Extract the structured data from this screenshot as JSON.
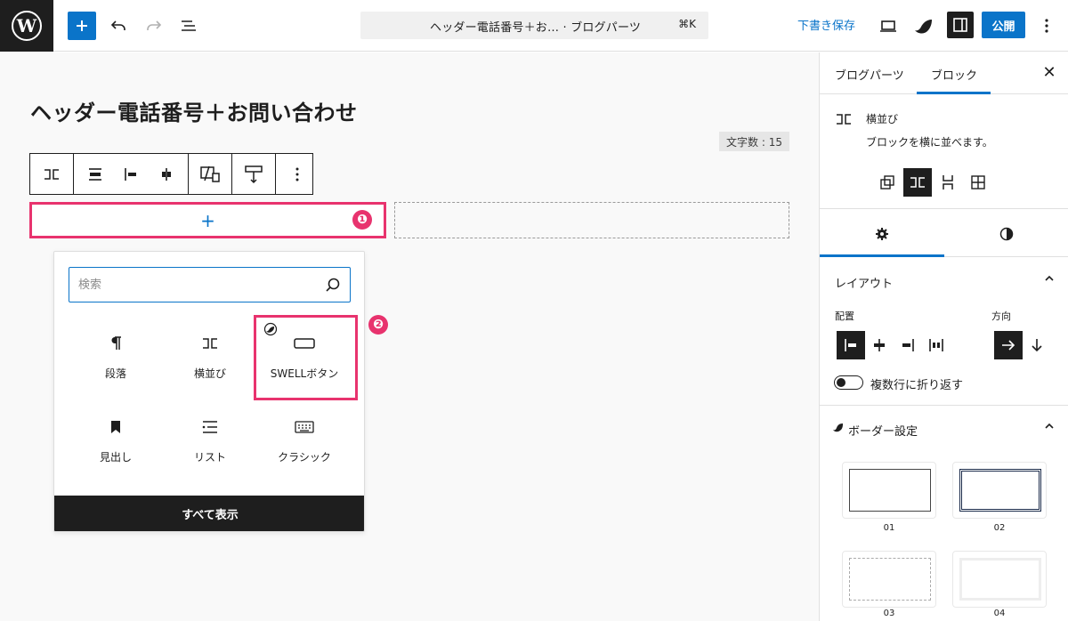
{
  "topbar": {
    "doc_title": "ヘッダー電話番号＋お…  · ブログパーツ",
    "shortcut": "⌘K",
    "draft_label": "下書き保存",
    "publish_label": "公開"
  },
  "canvas": {
    "post_title": "ヘッダー電話番号＋お問い合わせ",
    "char_count": "文字数 : 15",
    "inserter_plus": "+",
    "badge1": "❶",
    "badge2": "❷"
  },
  "inserter": {
    "search_placeholder": "検索",
    "blocks": [
      {
        "label": "段落",
        "icon": "paragraph-icon"
      },
      {
        "label": "横並び",
        "icon": "row-icon"
      },
      {
        "label": "SWELLボタン",
        "icon": "button-icon"
      },
      {
        "label": "見出し",
        "icon": "bookmark-icon"
      },
      {
        "label": "リスト",
        "icon": "list-icon"
      },
      {
        "label": "クラシック",
        "icon": "keyboard-icon"
      }
    ],
    "show_all": "すべて表示"
  },
  "sidebar": {
    "tabs": [
      "ブログパーツ",
      "ブロック"
    ],
    "active_tab": "ブロック",
    "close": "✕",
    "block_name": "横並び",
    "block_desc": "ブロックを横に並べます。",
    "layout_title": "レイアウト",
    "justify_label": "配置",
    "direction_label": "方向",
    "wrap_label": "複数行に折り返す",
    "border_title": "ボーダー設定",
    "border_options": [
      "01",
      "02",
      "03",
      "04"
    ]
  },
  "colors": {
    "accent": "#0a74c9",
    "highlight": "#e8336e",
    "dark": "#1e1e1e"
  }
}
